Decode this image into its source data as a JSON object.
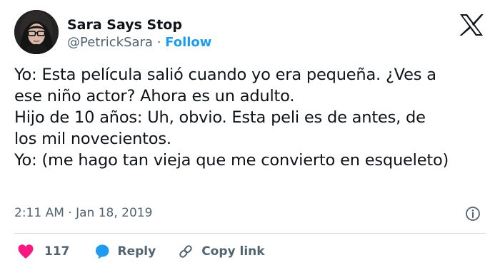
{
  "author": {
    "display_name": "Sara Says Stop",
    "handle": "@PetrickSara",
    "separator": "·",
    "follow_label": "Follow"
  },
  "tweet": {
    "lines": [
      "Yo: Esta película salió cuando yo era pequeña. ¿Ves a",
      "ese niño actor? Ahora es un adulto.",
      "Hijo de 10 años: Uh, obvio. Esta peli es de antes, de",
      "los mil novecientos.",
      "Yo: (me hago tan vieja que me convierto en esqueleto)"
    ],
    "timestamp": "2:11 AM · Jan 18, 2019"
  },
  "actions": {
    "like_count": "117",
    "reply_label": "Reply",
    "copy_link_label": "Copy link"
  },
  "icons": {
    "logo": "x-logo-icon",
    "info": "info-icon",
    "like": "heart-icon",
    "reply": "speech-bubble-icon",
    "copy": "link-icon"
  },
  "colors": {
    "accent": "#1d9bf0",
    "like": "#f91880",
    "text": "#0f1419",
    "muted": "#536471",
    "divider": "#cfd9de"
  }
}
